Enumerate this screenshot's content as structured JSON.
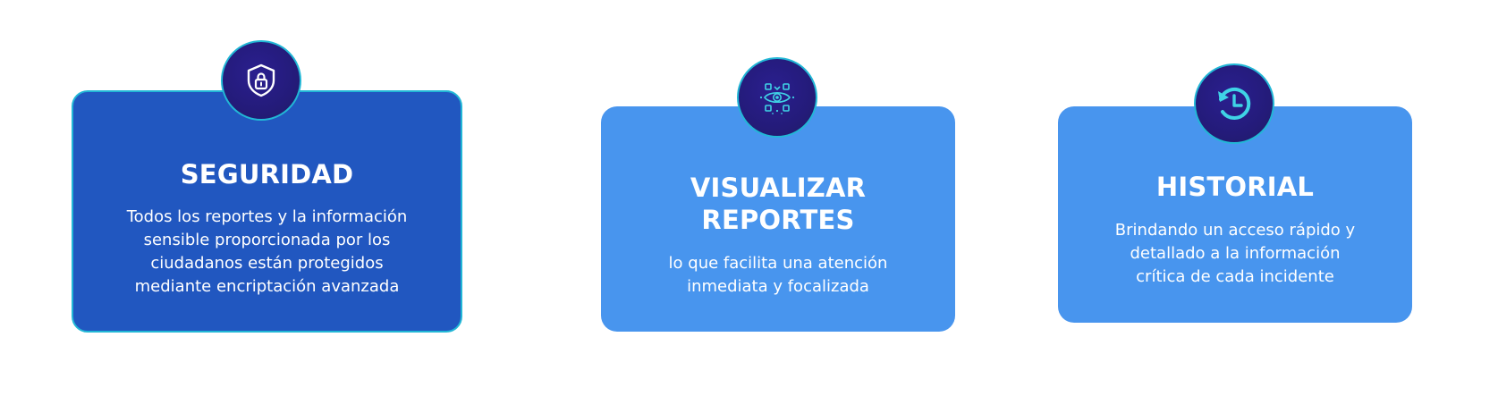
{
  "colors": {
    "card_active_bg": "#2157c0",
    "card_bg": "#4895ee",
    "badge_bg": "#241b7a",
    "accent_cyan": "#22b7d6",
    "text": "#ffffff"
  },
  "cards": [
    {
      "icon": "shield-lock-icon",
      "title": "SEGURIDAD",
      "description_lines": [
        "Todos los reportes y la información",
        "sensible proporcionada por los",
        "ciudadanos están protegidos",
        "mediante encriptación avanzada"
      ]
    },
    {
      "icon": "eye-scan-icon",
      "title_lines": [
        "VISUALIZAR",
        "REPORTES"
      ],
      "description_lines": [
        "lo que facilita una atención",
        "inmediata y focalizada"
      ]
    },
    {
      "icon": "history-clock-icon",
      "title": "HISTORIAL",
      "description_lines": [
        "Brindando un acceso rápido y",
        "detallado a la información",
        "crítica de cada incidente"
      ]
    }
  ]
}
